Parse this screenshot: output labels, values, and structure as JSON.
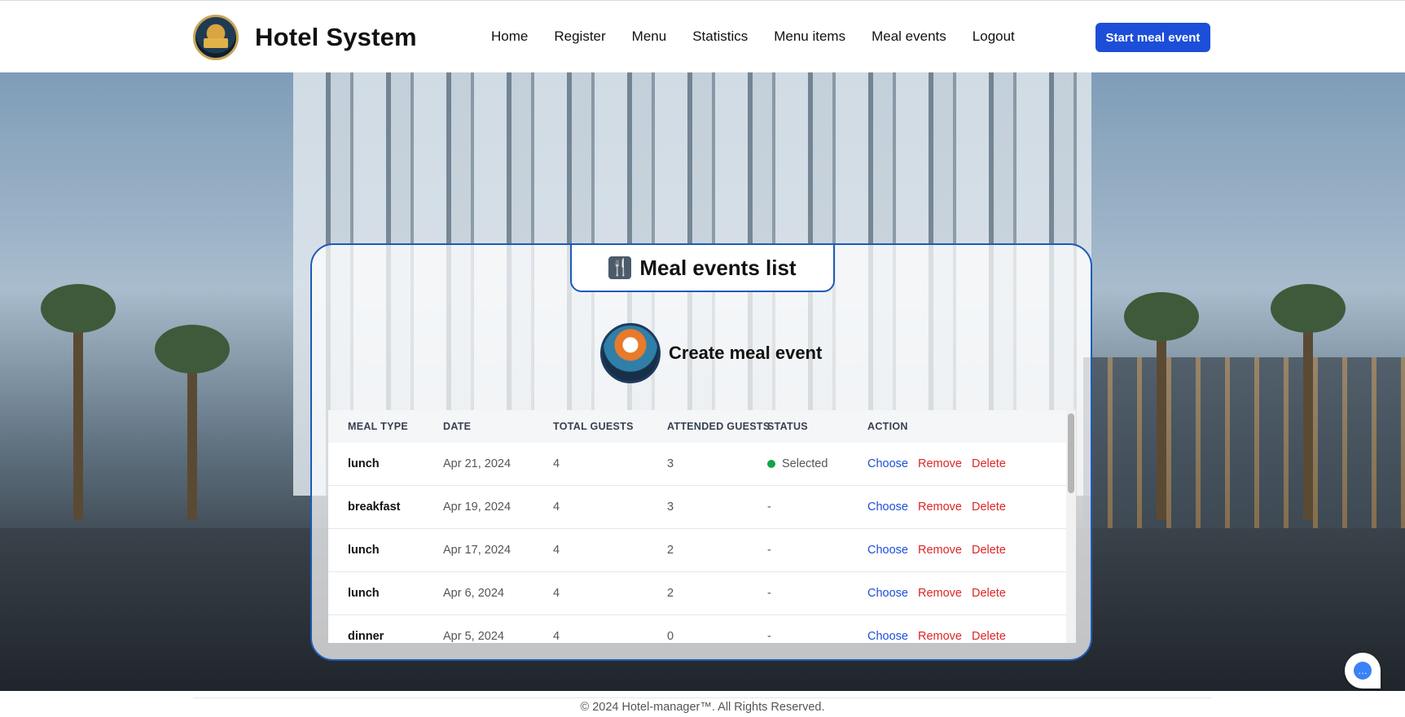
{
  "brand": {
    "title": "Hotel System"
  },
  "nav": {
    "items": [
      "Home",
      "Register",
      "Menu",
      "Statistics",
      "Menu items",
      "Meal events",
      "Logout"
    ]
  },
  "header": {
    "cta_label": "Start meal event"
  },
  "card": {
    "title": "Meal events list",
    "create_label": "Create meal event"
  },
  "table": {
    "columns": [
      "MEAL TYPE",
      "DATE",
      "TOTAL GUESTS",
      "ATTENDED GUESTS",
      "STATUS",
      "ACTION"
    ],
    "actions": {
      "choose": "Choose",
      "remove": "Remove",
      "delete": "Delete"
    },
    "rows": [
      {
        "meal_type": "lunch",
        "date": "Apr 21, 2024",
        "total_guests": "4",
        "attended_guests": "3",
        "status": "Selected"
      },
      {
        "meal_type": "breakfast",
        "date": "Apr 19, 2024",
        "total_guests": "4",
        "attended_guests": "3",
        "status": "-"
      },
      {
        "meal_type": "lunch",
        "date": "Apr 17, 2024",
        "total_guests": "4",
        "attended_guests": "2",
        "status": "-"
      },
      {
        "meal_type": "lunch",
        "date": "Apr 6, 2024",
        "total_guests": "4",
        "attended_guests": "2",
        "status": "-"
      },
      {
        "meal_type": "dinner",
        "date": "Apr 5, 2024",
        "total_guests": "4",
        "attended_guests": "0",
        "status": "-"
      }
    ]
  },
  "colors": {
    "accent": "#1d4ed8",
    "danger": "#dc2626",
    "status_selected": "#16a34a",
    "card_border": "#1d5ab8"
  },
  "footer": {
    "text": "© 2024 Hotel-manager™. All Rights Reserved."
  }
}
